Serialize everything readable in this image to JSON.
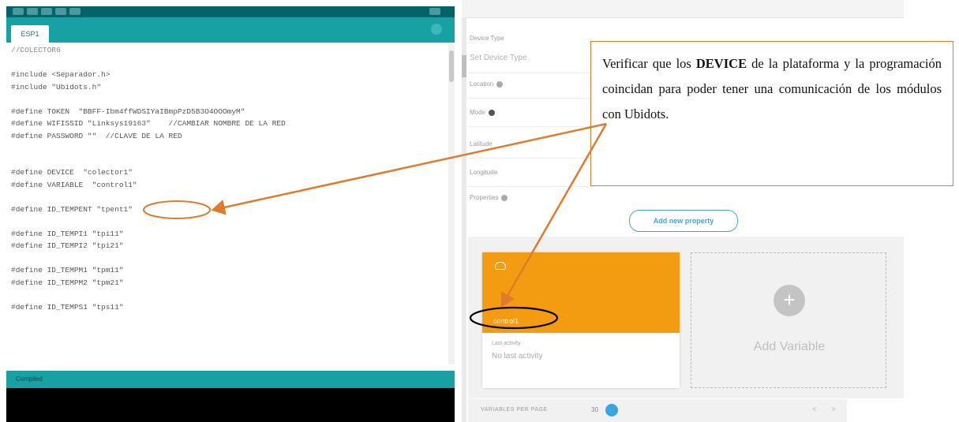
{
  "ide": {
    "tab_label": "ESP1",
    "code": [
      {
        "kind": "comment",
        "text": "//COLECTOR6"
      },
      {
        "kind": "blank",
        "text": ""
      },
      {
        "kind": "define",
        "text": "#include <Separador.h>"
      },
      {
        "kind": "define",
        "text": "#include \"Ubidots.h\""
      },
      {
        "kind": "blank",
        "text": ""
      },
      {
        "kind": "define",
        "text": "#define TOKEN  \"BBFF-Ibm4ffWDSIYaIBmpPzD5B3O4OOOmyM\""
      },
      {
        "kind": "define",
        "text": "#define WIFISSID \"Linksys19163\"    //CAMBIAR NOMBRE DE LA RED"
      },
      {
        "kind": "define",
        "text": "#define PASSWORD \"\"  //CLAVE DE LA RED"
      },
      {
        "kind": "blank",
        "text": ""
      },
      {
        "kind": "blank",
        "text": ""
      },
      {
        "kind": "define",
        "text": "#define DEVICE  \"colector1\""
      },
      {
        "kind": "define",
        "text": "#define VARIABLE  \"control1\""
      },
      {
        "kind": "blank",
        "text": ""
      },
      {
        "kind": "define",
        "text": "#define ID_TEMPENT \"tpent1\""
      },
      {
        "kind": "blank",
        "text": ""
      },
      {
        "kind": "define",
        "text": "#define ID_TEMPI1 \"tpi11\""
      },
      {
        "kind": "define",
        "text": "#define ID_TEMPI2 \"tpi21\""
      },
      {
        "kind": "blank",
        "text": ""
      },
      {
        "kind": "define",
        "text": "#define ID_TEMPM1 \"tpm11\""
      },
      {
        "kind": "define",
        "text": "#define ID_TEMPM2 \"tpm21\""
      },
      {
        "kind": "blank",
        "text": ""
      },
      {
        "kind": "define",
        "text": "#define ID_TEMPS1 \"tps11\""
      }
    ],
    "status_text": "Compiled"
  },
  "ubidots": {
    "properties": [
      {
        "label": "Device Type",
        "value": "Set Device Type"
      },
      {
        "label": "Location",
        "value": ""
      },
      {
        "label": "Mode",
        "value": ""
      },
      {
        "label": "Latitude",
        "value": ""
      },
      {
        "label": "Longitude",
        "value": ""
      },
      {
        "label": "Properties",
        "value": ""
      }
    ],
    "add_property_label": "Add new property",
    "variable_card": {
      "name": "control1",
      "last_activity_label": "Last activity",
      "last_activity_value": "No last activity"
    },
    "add_variable_label": "Add Variable",
    "pager": {
      "vars_per_page_label": "VARIABLES PER PAGE",
      "vars_per_page_value": "30",
      "prev": "<",
      "next": ">"
    }
  },
  "callout": {
    "text_before": "Verificar que los ",
    "text_bold": "DEVICE",
    "text_after": " de la plataforma y la programación coincidan para poder tener una comunicación de los módulos con Ubidots."
  },
  "colors": {
    "ide_teal": "#17a1a5",
    "ide_dark": "#006468",
    "ubidots_orange": "#f39c12",
    "annotation_orange": "#e07a2c",
    "accent_blue": "#3aa6e0"
  }
}
